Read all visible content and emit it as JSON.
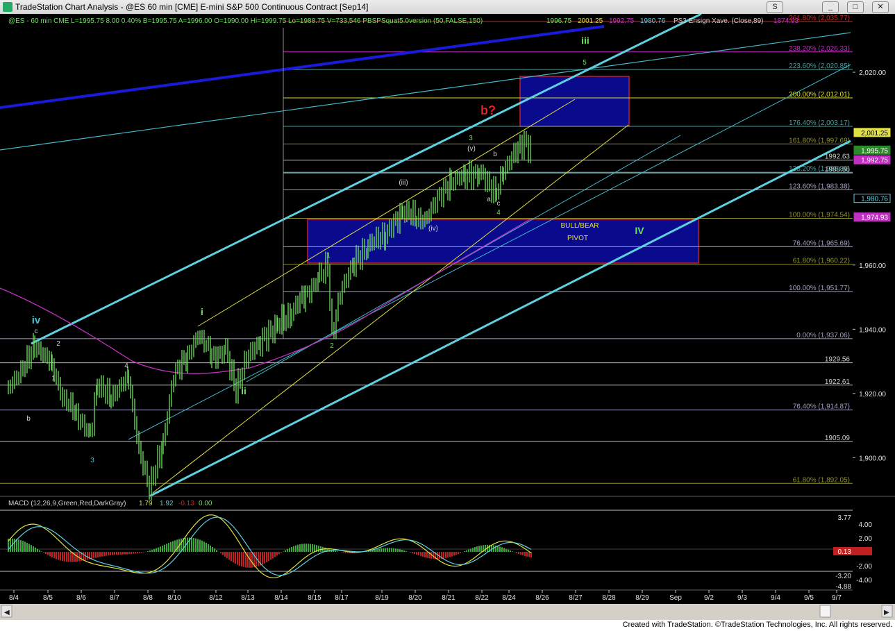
{
  "window": {
    "title": "TradeStation Chart Analysis - @ES 60 min [CME] E-mini S&P 500 Continuous Contract [Sep14]",
    "buttons": {
      "s": "S",
      "min": "_",
      "max": "□",
      "close": "✕"
    }
  },
  "header": {
    "symbol_line": "@ES - 60 min  CME  L=1995.75  8.00   0.40%  B=1995.75  A=1996.00  O=1990.00   Hi=1999.75  Lo=1988.75  V=733,546  PBSPSquat5.0version (50,FALSE,150)",
    "ind_values": [
      "1996.75",
      "2001.25",
      "1992.75",
      "1980.76"
    ],
    "ensign_label": "PS3 Ensign Xave. (Close,89)",
    "ensign_value": "1874.93"
  },
  "macd_header": {
    "label": "MACD (12,26,9,Green,Red,DarkGray)",
    "values": [
      "1.79",
      "1.92",
      "-0.13",
      "0.00"
    ]
  },
  "footer": {
    "text": "Created with TradeStation. ©TradeStation Technologies, Inc. All rights reserved."
  },
  "colors": {
    "background": "#000000",
    "bars": "#6ee060",
    "cyan": "#5fd0e0",
    "blue_line": "#1a1adc",
    "yellow": "#e0e040",
    "magenta": "#c030c0",
    "box_fill": "#0a0a8c",
    "box_border": "#c02030"
  },
  "chart_data": {
    "type": "candlestick",
    "ylim": [
      1888,
      2036
    ],
    "price_axis_ticks": [
      "2,020.00",
      "1,960.00",
      "1,940.00",
      "1,920.00",
      "1,900.00"
    ],
    "price_labels": [
      {
        "text": "2,001.25",
        "style": "yellow"
      },
      {
        "text": "1,995.75",
        "style": "green"
      },
      {
        "text": "1,992.75",
        "style": "magenta"
      },
      {
        "text": "1,980.76",
        "style": "cyan"
      },
      {
        "text": "1,974.93",
        "style": "magenta"
      }
    ],
    "fib_levels": [
      {
        "text": "261.80% (2,035.77)",
        "value": 2035.77,
        "color": "#c0302a"
      },
      {
        "text": "238.20% (2,026.33)",
        "value": 2026.33,
        "color": "#c030c0"
      },
      {
        "text": "223.60% (2,020.85)",
        "value": 2020.85,
        "color": "#40a0a0"
      },
      {
        "text": "200.00% (2,012.01)",
        "value": 2012.01,
        "color": "#e0e040"
      },
      {
        "text": "176.40% (2,003.17)",
        "value": 2003.17,
        "color": "#40a0a0"
      },
      {
        "text": "161.80% (1,997.69)",
        "value": 1997.69,
        "color": "#909030"
      },
      {
        "text": "1992.63",
        "value": 1992.63,
        "color": "#c0c0c0"
      },
      {
        "text": "138.20% (1,988.86)",
        "value": 1988.86,
        "color": "#40a0a0"
      },
      {
        "text": "1988.66",
        "value": 1988.66,
        "color": "#c0c0c0"
      },
      {
        "text": "123.60% (1,983.38)",
        "value": 1983.38,
        "color": "#a0a0c0"
      },
      {
        "text": "100.00% (1,974.54)",
        "value": 1974.54,
        "color": "#909030"
      },
      {
        "text": "76.40% (1,965.69)",
        "value": 1965.69,
        "color": "#a0a0c0"
      },
      {
        "text": "61.80% (1,960.22)",
        "value": 1960.22,
        "color": "#909030"
      },
      {
        "text": "100.00% (1,951.77)",
        "value": 1951.77,
        "color": "#a0a0c0"
      },
      {
        "text": "0.00% (1,937.06)",
        "value": 1937.06,
        "color": "#a0a0c0"
      },
      {
        "text": "1929.56",
        "value": 1929.56,
        "color": "#c0c0c0"
      },
      {
        "text": "1922.61",
        "value": 1922.61,
        "color": "#c0c0c0"
      },
      {
        "text": "76.40% (1,914.87)",
        "value": 1914.87,
        "color": "#a0a0c0"
      },
      {
        "text": "1905.09",
        "value": 1905.09,
        "color": "#c0c0c0"
      },
      {
        "text": "61.80% (1,892.05)",
        "value": 1892.05,
        "color": "#909030"
      }
    ],
    "x_labels": [
      "8/4",
      "8/5",
      "8/6",
      "8/7",
      "8/8",
      "8/10",
      "8/12",
      "8/13",
      "8/14",
      "8/15",
      "8/17",
      "8/19",
      "8/20",
      "8/21",
      "8/22",
      "8/24",
      "8/26",
      "8/27",
      "8/28",
      "8/29",
      "Sep",
      "9/2",
      "9/3",
      "9/4",
      "9/5",
      "9/7"
    ],
    "wave_labels": [
      {
        "text": "iv",
        "color": "#40c0d0"
      },
      {
        "text": "c",
        "color": "#d0d0d0"
      },
      {
        "text": "2",
        "color": "#d0d0d0"
      },
      {
        "text": "1",
        "color": "#d0d0d0"
      },
      {
        "text": "b",
        "color": "#d0d0d0"
      },
      {
        "text": "4",
        "color": "#d0d0d0"
      },
      {
        "text": "3",
        "color": "#40c0d0"
      },
      {
        "text": "i",
        "color": "#6ee060"
      },
      {
        "text": "ii",
        "color": "#6ee060"
      },
      {
        "text": "1",
        "color": "#6ee060"
      },
      {
        "text": "2",
        "color": "#6ee060"
      },
      {
        "text": "(iii)",
        "color": "#d0d0d0"
      },
      {
        "text": "(iv)",
        "color": "#d0d0d0"
      },
      {
        "text": "(v)",
        "color": "#d0d0d0"
      },
      {
        "text": "3",
        "color": "#6ee060"
      },
      {
        "text": "b",
        "color": "#d0d0d0"
      },
      {
        "text": "a",
        "color": "#d0d0d0"
      },
      {
        "text": "c",
        "color": "#d0d0d0"
      },
      {
        "text": "4",
        "color": "#6ee060"
      },
      {
        "text": "b?",
        "color": "#e02020"
      },
      {
        "text": "5",
        "color": "#6ee060"
      },
      {
        "text": "iii",
        "color": "#6ee060"
      },
      {
        "text": "IV",
        "color": "#6ee060"
      }
    ],
    "pivot_box": {
      "line1": "BULL/BEAR",
      "line2": "PIVOT",
      "y_range": [
        1960.22,
        1974.54
      ]
    },
    "target_box": {
      "y_range": [
        2003.17,
        2020.85
      ]
    },
    "macd": {
      "ylim": [
        -5.5,
        6
      ],
      "ticks": [
        "4.00",
        "2.00",
        "-2.00",
        "-4.00"
      ],
      "labels": [
        {
          "text": "3.77",
          "style": "plain"
        },
        {
          "text": "0.13",
          "style": "red"
        },
        {
          "text": "-3.20",
          "style": "plain"
        },
        {
          "text": "-4.88",
          "style": "plain"
        }
      ]
    }
  }
}
